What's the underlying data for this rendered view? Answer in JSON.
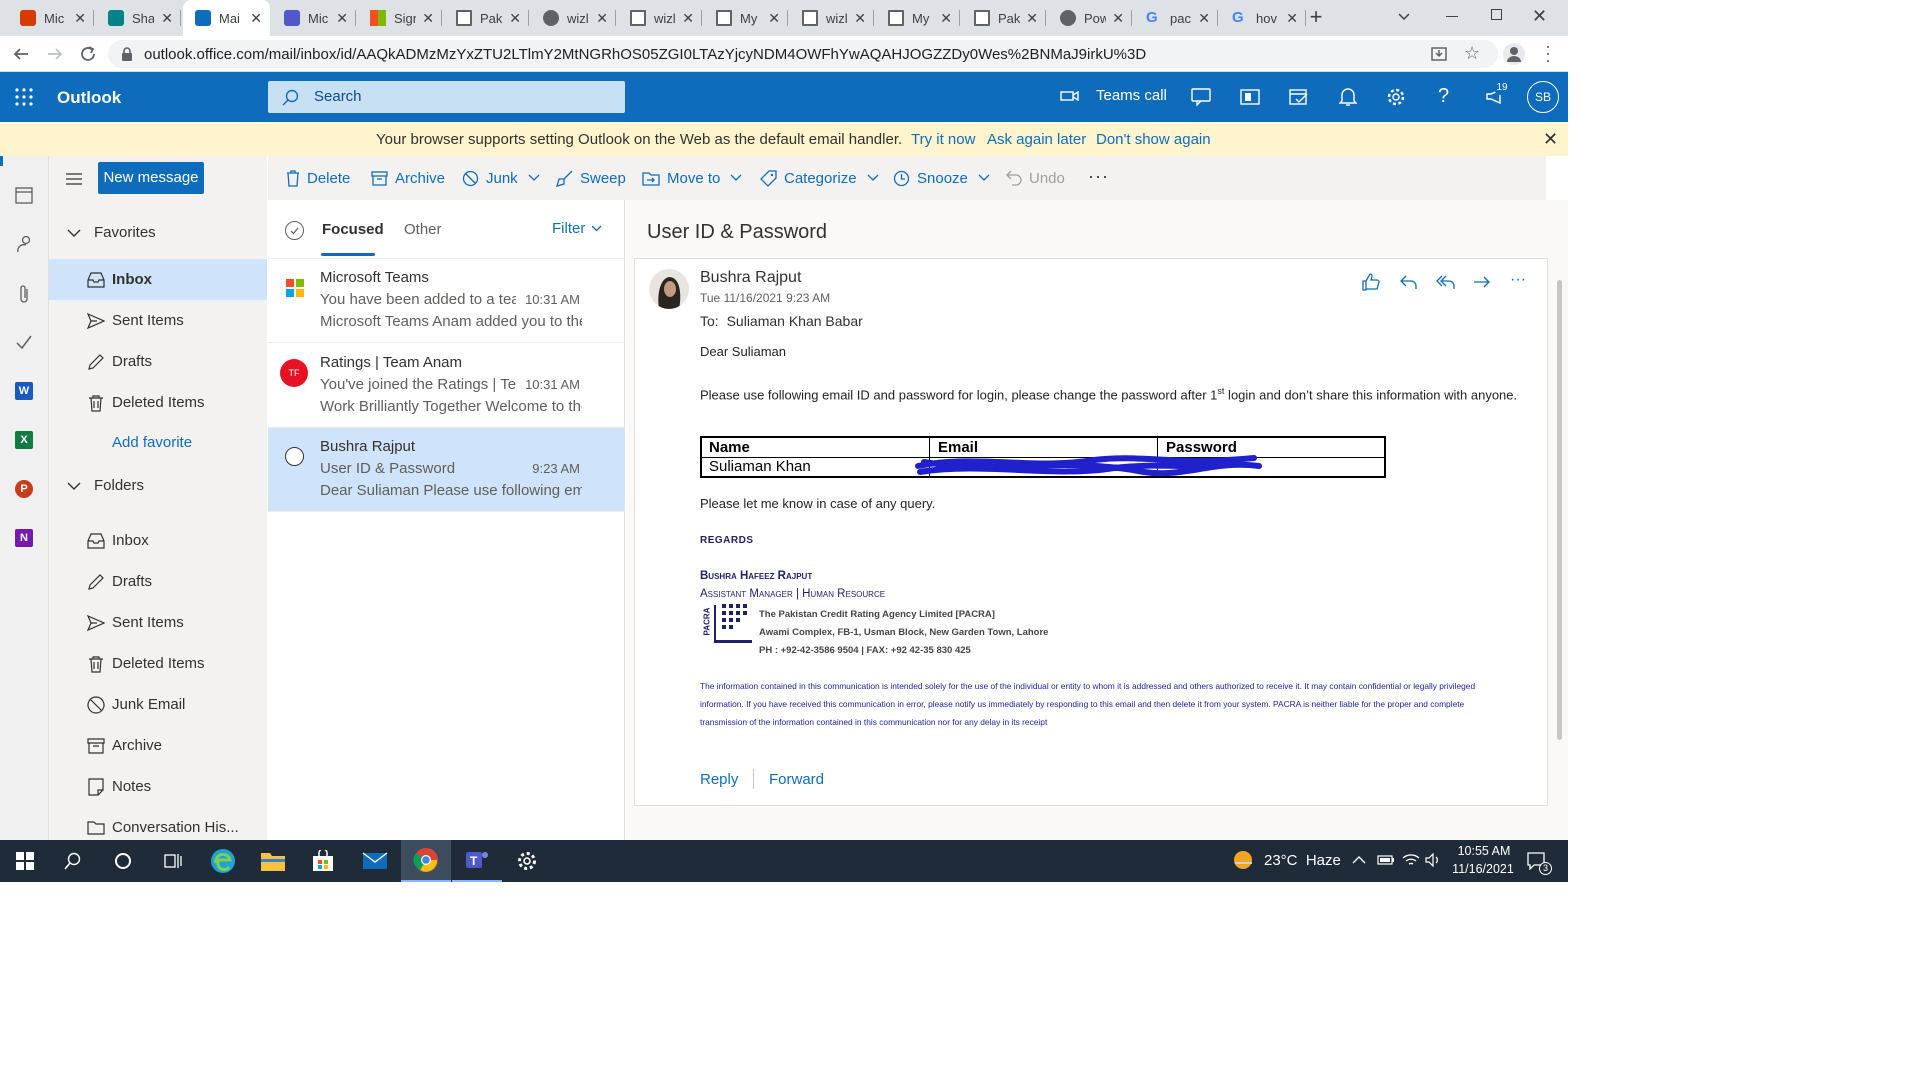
{
  "browser": {
    "tabs": [
      {
        "label": "Mic",
        "icon": "office-icon"
      },
      {
        "label": "Sha",
        "icon": "sharepoint-icon"
      },
      {
        "label": "Mai",
        "icon": "outlook-icon",
        "active": true
      },
      {
        "label": "Mic",
        "icon": "teams-icon"
      },
      {
        "label": "Sign",
        "icon": "microsoft-icon"
      },
      {
        "label": "Pak",
        "icon": "document-icon"
      },
      {
        "label": "wizl",
        "icon": "globe-icon"
      },
      {
        "label": "wizl",
        "icon": "document-icon"
      },
      {
        "label": "My",
        "icon": "document-icon"
      },
      {
        "label": "wizl",
        "icon": "document-icon"
      },
      {
        "label": "My",
        "icon": "document-icon"
      },
      {
        "label": "Pak",
        "icon": "document-icon"
      },
      {
        "label": "Pow",
        "icon": "globe-icon"
      },
      {
        "label": "pac",
        "icon": "google-icon"
      },
      {
        "label": "hov",
        "icon": "google-icon"
      }
    ],
    "url": "outlook.office.com/mail/inbox/id/AAQkADMzMzYxZTU2LTlmY2MtNGRhOS05ZGI0LTAzYjcyNDM4OWFhYwAQAHJOGZZDy0Wes%2BNMaJ9irkU%3D"
  },
  "header": {
    "app_name": "Outlook",
    "search_placeholder": "Search",
    "teams_call_label": "Teams call",
    "notification_count": "19",
    "avatar_initials": "SB"
  },
  "banner": {
    "message": "Your browser supports setting Outlook on the Web as the default email handler.",
    "try_label": "Try it now",
    "ask_label": "Ask again later",
    "dont_label": "Don't show again"
  },
  "folders": {
    "new_message_label": "New message",
    "favorites_label": "Favorites",
    "favorites": [
      {
        "label": "Inbox",
        "icon": "inbox-icon",
        "selected": true
      },
      {
        "label": "Sent Items",
        "icon": "send-icon"
      },
      {
        "label": "Drafts",
        "icon": "pencil-icon"
      },
      {
        "label": "Deleted Items",
        "icon": "trash-icon"
      }
    ],
    "add_favorite_label": "Add favorite",
    "folders_label": "Folders",
    "folders": [
      {
        "label": "Inbox",
        "icon": "inbox-icon"
      },
      {
        "label": "Drafts",
        "icon": "pencil-icon"
      },
      {
        "label": "Sent Items",
        "icon": "send-icon"
      },
      {
        "label": "Deleted Items",
        "icon": "trash-icon"
      },
      {
        "label": "Junk Email",
        "icon": "block-icon"
      },
      {
        "label": "Archive",
        "icon": "archive-icon"
      },
      {
        "label": "Notes",
        "icon": "note-icon"
      },
      {
        "label": "Conversation His...",
        "icon": "folder-icon"
      }
    ]
  },
  "commands": {
    "delete": "Delete",
    "archive": "Archive",
    "junk": "Junk",
    "sweep": "Sweep",
    "move_to": "Move to",
    "categorize": "Categorize",
    "snooze": "Snooze",
    "undo": "Undo"
  },
  "list": {
    "focused_label": "Focused",
    "other_label": "Other",
    "filter_label": "Filter",
    "messages": [
      {
        "sender": "Microsoft Teams",
        "subject": "You have been added to a team",
        "time": "10:31 AM",
        "preview": "Microsoft Teams Anam added you to the",
        "avatar": "microsoft-logo"
      },
      {
        "sender": "Ratings | Team Anam",
        "subject": "You've joined the Ratings | Team",
        "time": "10:31 AM",
        "preview": "Work Brilliantly Together Welcome to the",
        "avatar_text": "TF",
        "avatar_color": "#e81123"
      },
      {
        "sender": "Bushra Rajput",
        "subject": "User ID & Password",
        "time": "9:23 AM",
        "preview": "Dear Suliaman Please use following email",
        "selected": true
      }
    ]
  },
  "reading": {
    "subject": "User ID & Password",
    "sender": "Bushra Rajput",
    "date": "Tue 11/16/2021 9:23 AM",
    "to_label": "To:",
    "to": "Suliaman Khan Babar",
    "greeting": "Dear Suliaman",
    "body_pre": "Please use following email ID and password for login, please change the password after 1",
    "body_sup": "st",
    "body_post": " login and don’t share this information with anyone.",
    "table_headers": [
      "Name",
      "Email",
      "Password"
    ],
    "table_row": [
      "Suliaman Khan",
      "",
      ""
    ],
    "closing": "Please let me know in case of any query.",
    "regards": "REGARDS",
    "sig_name": "Bushra Hafeez Rajput",
    "sig_title": "Assistant Manager | Human Resource",
    "sig_company": "The Pakistan Credit Rating Agency Limited [PACRA]",
    "sig_address": "Awami Complex, FB-1, Usman Block, New Garden Town, Lahore",
    "sig_phone": "PH : +92-42-3586 9504 | FAX: +92 42-35 830 425",
    "sig_logo_text": "PACRA",
    "disclaimer_1": "The information contained in this communication is intended solely for the use of the individual or entity to whom it is addressed and others authorized to receive it. It may contain confidential or legally privileged",
    "disclaimer_2": "information. If you have received this communication in error, please notify us immediately by responding to this email and then delete it from your system. PACRA is neither liable for the proper and complete",
    "disclaimer_3": "transmission of the information contained in this communication nor for any delay in its receipt",
    "reply_label": "Reply",
    "forward_label": "Forward"
  },
  "taskbar": {
    "weather": "23°C  Haze",
    "time": "10:55 AM",
    "date": "11/16/2021",
    "notif_count": "3"
  }
}
